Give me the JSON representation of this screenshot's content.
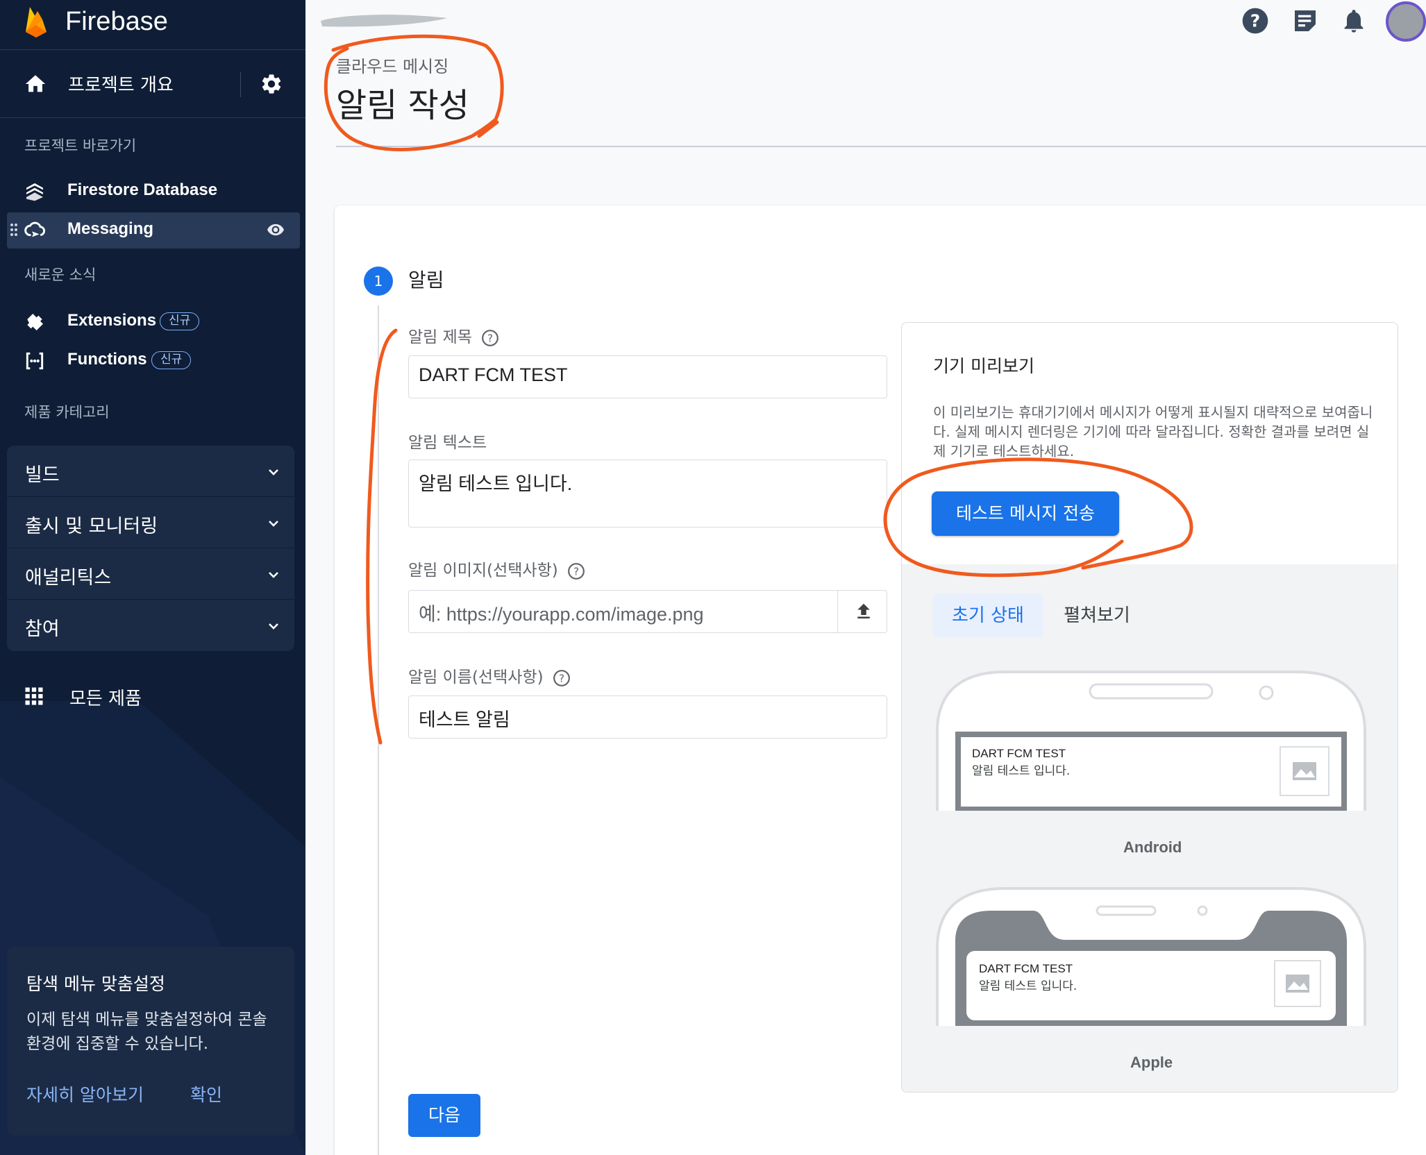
{
  "app": {
    "brand": "Firebase"
  },
  "sidebar": {
    "overview_label": "프로젝트 개요",
    "shortcuts_title": "프로젝트 바로가기",
    "shortcuts": [
      {
        "label": "Firestore Database",
        "icon": "firestore-icon"
      },
      {
        "label": "Messaging",
        "icon": "messaging-icon",
        "active": true
      }
    ],
    "news_title": "새로운 소식",
    "news": [
      {
        "label": "Extensions",
        "badge": "신규",
        "icon": "extensions-icon"
      },
      {
        "label": "Functions",
        "badge": "신규",
        "icon": "functions-icon"
      }
    ],
    "categories_title": "제품 카테고리",
    "categories": [
      {
        "label": "빌드"
      },
      {
        "label": "출시 및 모니터링"
      },
      {
        "label": "애널리틱스"
      },
      {
        "label": "참여"
      }
    ],
    "all_products": "모든 제품",
    "customize_card": {
      "title": "탐색 메뉴 맞춤설정",
      "description": "이제 탐색 메뉴를 맞춤설정하여 콘솔 환경에 집중할 수 있습니다.",
      "learn_more": "자세히 알아보기",
      "confirm": "확인"
    }
  },
  "header": {
    "breadcrumb": "클라우드 메시징",
    "title": "알림 작성"
  },
  "step": {
    "number": "1",
    "label": "알림"
  },
  "form": {
    "title_label": "알림 제목",
    "title_value": "DART FCM TEST",
    "text_label": "알림 텍스트",
    "text_value": "알림 테스트 입니다.",
    "image_label": "알림 이미지(선택사항)",
    "image_placeholder": "예: https://yourapp.com/image.png",
    "name_label": "알림 이름(선택사항)",
    "name_value": "테스트 알림",
    "next_button": "다음"
  },
  "preview": {
    "title": "기기 미리보기",
    "description": "이 미리보기는 휴대기기에서 메시지가 어떻게 표시될지 대략적으로 보여줍니다. 실제 메시지 렌더링은 기기에 따라 달라집니다. 정확한 결과를 보려면 실제 기기로 테스트하세요.",
    "test_button": "테스트 메시지 전송",
    "tabs": [
      {
        "label": "초기 상태",
        "active": true
      },
      {
        "label": "펼쳐보기",
        "active": false
      }
    ],
    "android": {
      "label": "Android",
      "notif_title": "DART FCM TEST",
      "notif_body": "알림 테스트 입니다."
    },
    "apple": {
      "label": "Apple",
      "notif_title": "DART FCM TEST",
      "notif_body": "알림 테스트 입니다."
    }
  },
  "colors": {
    "sidebar_bg": "#0f1e36",
    "accent": "#1a73e8",
    "annotation": "#f05a1e"
  }
}
